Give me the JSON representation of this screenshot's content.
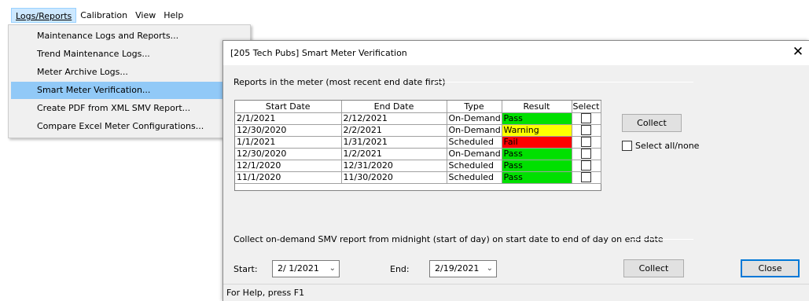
{
  "menubar": {
    "items": [
      {
        "label": "Logs/Reports",
        "active": true
      },
      {
        "label": "Calibration",
        "active": false
      },
      {
        "label": "View",
        "active": false
      },
      {
        "label": "Help",
        "active": false
      }
    ]
  },
  "dropdown": {
    "items": [
      {
        "label": "Maintenance Logs and Reports..."
      },
      {
        "label": "Trend Maintenance Logs..."
      },
      {
        "label": "Meter Archive Logs..."
      },
      {
        "label": "Smart Meter Verification...",
        "highlighted": true
      },
      {
        "label": "Create PDF from XML SMV Report..."
      },
      {
        "label": "Compare Excel Meter Configurations..."
      }
    ]
  },
  "dialog": {
    "title": "[205 Tech Pubs] Smart Meter Verification",
    "close_glyph": "✕",
    "reports_group_label": "Reports in the meter (most recent end date first)",
    "table": {
      "columns": [
        "Start Date",
        "End Date",
        "Type",
        "Result",
        "Select"
      ],
      "rows": [
        {
          "start": "2/1/2021",
          "end": "2/12/2021",
          "type": "On-Demand",
          "result": "Pass",
          "result_color": "#00e000"
        },
        {
          "start": "12/30/2020",
          "end": "2/2/2021",
          "type": "On-Demand",
          "result": "Warning",
          "result_color": "#ffff00"
        },
        {
          "start": "1/1/2021",
          "end": "1/31/2021",
          "type": "Scheduled",
          "result": "Fail",
          "result_color": "#ff0000"
        },
        {
          "start": "12/30/2020",
          "end": "1/2/2021",
          "type": "On-Demand",
          "result": "Pass",
          "result_color": "#00e000"
        },
        {
          "start": "12/1/2020",
          "end": "12/31/2020",
          "type": "Scheduled",
          "result": "Pass",
          "result_color": "#00e000"
        },
        {
          "start": "11/1/2020",
          "end": "11/30/2020",
          "type": "Scheduled",
          "result": "Pass",
          "result_color": "#00e000"
        }
      ]
    },
    "collect_top_label": "Collect",
    "select_all_label": "Select all/none",
    "ondemand_group_label": "Collect on-demand SMV report from midnight (start of day) on start date to end of day on end date",
    "start_label": "Start:",
    "start_value": "2/ 1/2021",
    "end_label": "End:",
    "end_value": "2/19/2021",
    "collect_bottom_label": "Collect",
    "close_label": "Close",
    "status_text": "For Help, press F1"
  }
}
